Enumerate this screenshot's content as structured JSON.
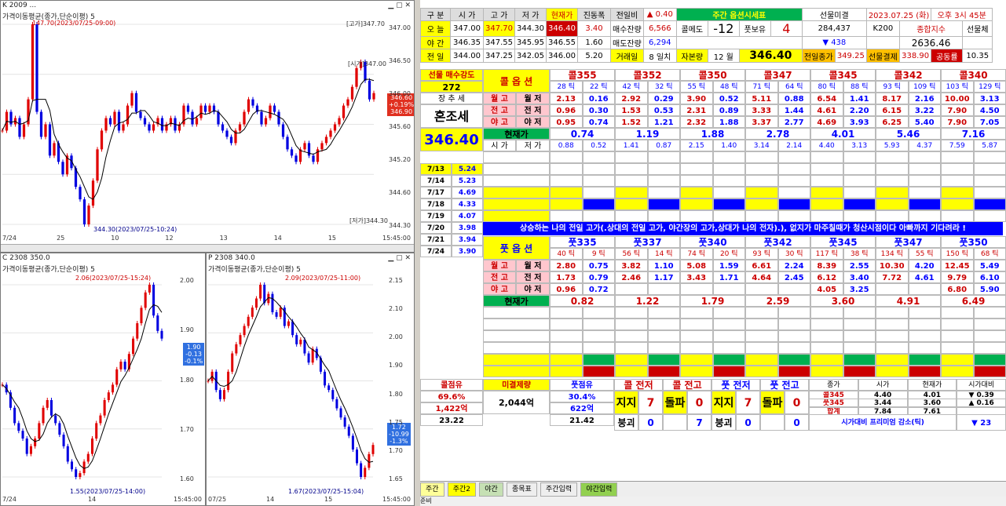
{
  "charts": {
    "top": {
      "title": "가격이동평균(종가,단순이평) 5",
      "header": "K 2009 ...",
      "max_label": "147.70(2023/07/25-09:00)",
      "high_label": "[고가]347.70",
      "open_label": "[시가]347.00",
      "low_label": "344.30(2023/07/25-10:24)",
      "low_box": "[저가]344.30",
      "price_tag": [
        "346.60",
        "+0.19%",
        "346.90"
      ],
      "yticks": [
        "347.00",
        "346.50",
        "346.00",
        "345.60",
        "345.20",
        "344.60",
        "344.30"
      ],
      "xticks": [
        "7/24",
        "25",
        "10",
        "12",
        "13",
        "14",
        "15",
        "15:45:00"
      ],
      "series": [
        345.8,
        346.1,
        345.9,
        346.0,
        345.7,
        345.9,
        346.3,
        347.5,
        346.1,
        345.7,
        345.9,
        345.4,
        345.6,
        345.3,
        345.1,
        345.4,
        345.2,
        344.9,
        344.7,
        344.3,
        344.6,
        345.0,
        345.5,
        345.8,
        346.0,
        345.9,
        346.1,
        345.8,
        345.9,
        346.2,
        346.4,
        346.1,
        346.0,
        345.9,
        345.8,
        345.9,
        346.0,
        345.8,
        345.9,
        346.0,
        345.8,
        345.9,
        346.2,
        346.1,
        345.9,
        346.0,
        346.2,
        346.1,
        346.2,
        346.1,
        345.9,
        345.8,
        345.7,
        345.6,
        345.8,
        345.9,
        346.1,
        346.3,
        346.2,
        346.1,
        345.9,
        346.0,
        346.2,
        346.1,
        345.9,
        345.7,
        345.5,
        345.4,
        345.3,
        345.5,
        345.6,
        345.4,
        345.3,
        345.5,
        345.6,
        345.7,
        345.8,
        345.9,
        346.0,
        346.2,
        346.3,
        346.5,
        346.8,
        346.9,
        346.6,
        346.3,
        346.4
      ]
    },
    "call": {
      "header": "C 2308 350.0",
      "title": "가격이동평균(종가,단순이평) 5",
      "hi_label": "2.06(2023/07/25-15:24)",
      "lo_label": "1.55(2023/07/25-14:00)",
      "yticks": [
        "2.00",
        "1.90",
        "1.80",
        "1.70",
        "1.60"
      ],
      "xticks": [
        "7/24",
        "14",
        "15:45:00"
      ],
      "price_tag": [
        "1.90",
        "-0.13",
        "-0.1%"
      ],
      "series": [
        1.8,
        1.78,
        1.74,
        1.7,
        1.68,
        1.66,
        1.62,
        1.64,
        1.66,
        1.7,
        1.74,
        1.76,
        1.72,
        1.7,
        1.67,
        1.64,
        1.6,
        1.58,
        1.56,
        1.57,
        1.6,
        1.62,
        1.66,
        1.7,
        1.72,
        1.76,
        1.78,
        1.8,
        1.84,
        1.86,
        1.84,
        1.88,
        1.92,
        1.96,
        2.0,
        2.04,
        2.06,
        1.98,
        1.94,
        1.92
      ]
    },
    "put": {
      "header": "P 2308 340.0",
      "title": "가격이동평균(종가,단순이평) 5",
      "hi_label": "2.09(2023/07/25-11:00)",
      "lo_label": "1.67(2023/07/25-15:04)",
      "yticks": [
        "2.15",
        "2.10",
        "2.00",
        "1.90",
        "1.80",
        "1.75",
        "1.70",
        "1.65"
      ],
      "xticks": [
        "07/25",
        "14",
        "15",
        "15:45:00"
      ],
      "price_tag": [
        "1.72",
        "-10.99",
        "-1.3%"
      ],
      "series": [
        1.88,
        1.9,
        1.86,
        1.84,
        1.86,
        1.9,
        1.94,
        1.96,
        1.98,
        2.0,
        2.02,
        2.04,
        2.06,
        2.09,
        2.05,
        2.07,
        2.03,
        2.02,
        2.04,
        2.0,
        2.01,
        1.98,
        1.96,
        1.97,
        1.94,
        1.92,
        1.95,
        1.93,
        1.9,
        1.87,
        1.86,
        1.84,
        1.82,
        1.8,
        1.78,
        1.76,
        1.73,
        1.7,
        1.67,
        1.69,
        1.72,
        1.74
      ]
    }
  },
  "sheet": {
    "r0": [
      "구 분",
      "시 가",
      "고 가",
      "저 가",
      "현재가",
      "진동폭",
      "전일비",
      "▲ 0.40",
      "주간 옵션시세표",
      "",
      "선물미결",
      "",
      "2023.07.25 (화)",
      "오후 3시 45분"
    ],
    "r1": [
      "오 늘",
      "347.00",
      "347.70",
      "344.30",
      "346.40",
      "3.40",
      "매수잔량",
      "6,566",
      "콜메도",
      "-12",
      "풋보유",
      "4",
      "284,437",
      "K200",
      "종합지수",
      "선물체"
    ],
    "r2": [
      "야 간",
      "346.35",
      "347.55",
      "345.95",
      "346.55",
      "1.60",
      "매도잔량",
      "6,294",
      "",
      "",
      "",
      "",
      "▼ 438",
      "",
      "2636.46",
      ""
    ],
    "r3": [
      "전 일",
      "344.00",
      "347.25",
      "342.05",
      "346.00",
      "5.20",
      "거래일",
      "8 일치",
      "자본량",
      "12 월",
      "346.40",
      "",
      "전일종가",
      "349.25",
      "선물결제",
      "338.90",
      "공동률",
      "10.35"
    ],
    "call_header": [
      "선물 매수강도",
      "콜 옵 션",
      "콜355",
      "콜352",
      "콜350",
      "콜347",
      "콜345",
      "콜342",
      "콜340"
    ],
    "call_ticks": [
      "272",
      "",
      "28 틱",
      "22 틱",
      "42 틱",
      "32 틱",
      "55 틱",
      "48 틱",
      "71 틱",
      "64 틱",
      "80 틱",
      "88 틱",
      "93 틱",
      "109 틱",
      "103 틱",
      "129 틱"
    ],
    "trend_label": "장 추 세",
    "trend_value": "혼조세",
    "current_price": "346.40",
    "rows_call": [
      [
        "월 고",
        "월 저",
        "2.13",
        "0.16",
        "2.92",
        "0.29",
        "3.90",
        "0.52",
        "5.11",
        "0.88",
        "6.54",
        "1.41",
        "8.17",
        "2.16",
        "10.00",
        "3.13"
      ],
      [
        "전 고",
        "전 저",
        "0.96",
        "0.30",
        "1.53",
        "0.53",
        "2.31",
        "0.89",
        "3.33",
        "1.44",
        "4.61",
        "2.20",
        "6.15",
        "3.22",
        "7.90",
        "4.50"
      ],
      [
        "야 고",
        "야 저",
        "0.95",
        "0.74",
        "1.52",
        "1.21",
        "2.32",
        "1.88",
        "3.37",
        "2.77",
        "4.69",
        "3.93",
        "6.25",
        "5.40",
        "7.90",
        "7.05"
      ]
    ],
    "call_now_label": "현재가",
    "call_now": [
      "0.74",
      "1.19",
      "1.88",
      "2.78",
      "4.01",
      "5.46",
      "7.16"
    ],
    "call_open_row": [
      "시 가",
      "저 가",
      "0.88",
      "0.52",
      "1.41",
      "0.87",
      "2.15",
      "1.40",
      "3.14",
      "2.14",
      "4.40",
      "3.13",
      "5.93",
      "4.37",
      "7.59",
      "5.87"
    ],
    "dates": [
      "7/13",
      "7/14",
      "7/17",
      "7/18",
      "7/19",
      "7/20",
      "7/21",
      "7/24"
    ],
    "date_vals": [
      "5.24",
      "5.23",
      "4.69",
      "4.33",
      "4.07",
      "3.98",
      "3.94",
      "3.90"
    ],
    "notice": "상승하는 나의 전일 고가(.상대의 전일 고가, 야간장의 고가,상대가 나의 전자).), 없지가 마주칠때가 청산시점이다 아빠까지 기다려라 !",
    "put_header": [
      "풋 옵 션",
      "풋335",
      "풋337",
      "풋340",
      "풋342",
      "풋345",
      "풋347",
      "풋350"
    ],
    "put_ticks": [
      "40 틱",
      "9 틱",
      "56 틱",
      "14 틱",
      "74 틱",
      "20 틱",
      "93 틱",
      "30 틱",
      "117 틱",
      "38 틱",
      "134 틱",
      "55 틱",
      "150 틱",
      "68 틱"
    ],
    "rows_put": [
      [
        "월 고",
        "월 저",
        "2.80",
        "0.75",
        "3.82",
        "1.10",
        "5.08",
        "1.59",
        "6.61",
        "2.24",
        "8.39",
        "2.55",
        "10.30",
        "4.20",
        "12.45",
        "5.49"
      ],
      [
        "전 고",
        "전 저",
        "1.73",
        "0.79",
        "2.46",
        "1.17",
        "3.43",
        "1.71",
        "4.64",
        "2.45",
        "6.12",
        "3.40",
        "7.72",
        "4.61",
        "9.79",
        "6.10"
      ],
      [
        "야 고",
        "야 저",
        "0.96",
        "0.72",
        "",
        "",
        "",
        "",
        "",
        "",
        "4.05",
        "3.25",
        "",
        "",
        "6.80",
        "5.90"
      ]
    ],
    "put_now": [
      "0.82",
      "1.22",
      "1.79",
      "2.59",
      "3.60",
      "4.91",
      "6.49"
    ],
    "bottom": {
      "a": [
        "콜점유",
        "69.6%",
        "1,422억",
        "23.22"
      ],
      "b": [
        "미결제량",
        "2,044억"
      ],
      "c": [
        "풋점유",
        "30.4%",
        "622억",
        "21.42"
      ],
      "labels": [
        "콜 전저",
        "콜 전고",
        "풋 전저",
        "풋 전고"
      ],
      "vals": [
        "지지",
        "7",
        "돌파",
        "0",
        "지지",
        "7",
        "돌파",
        "0"
      ],
      "vals2": [
        "붕괴",
        "0",
        "",
        "7",
        "붕괴",
        "0",
        "",
        "0"
      ],
      "mini_head": [
        "종가",
        "시가",
        "현재가",
        "시가대비"
      ],
      "mini1": [
        "콜345",
        "4.40",
        "4.01",
        "▼ 0.39"
      ],
      "mini2": [
        "풋345",
        "3.44",
        "3.60",
        "▲ 0.16"
      ],
      "mini3": [
        "합계",
        "7.84",
        "7.61",
        ""
      ],
      "footer": "시가대비 프리미엄 감소(틱)",
      "footer_val": "▼ 23"
    },
    "tabs": [
      "주간",
      "주간2",
      "야간",
      "종목표",
      "주간입력",
      "야간입력"
    ],
    "status": "준비"
  },
  "colors": {
    "red": "#ff0000",
    "blue": "#0000ff",
    "green": "#00b050",
    "yellow": "#ffff00",
    "header_bg": "#ffd966",
    "orange": "#ffc000"
  }
}
